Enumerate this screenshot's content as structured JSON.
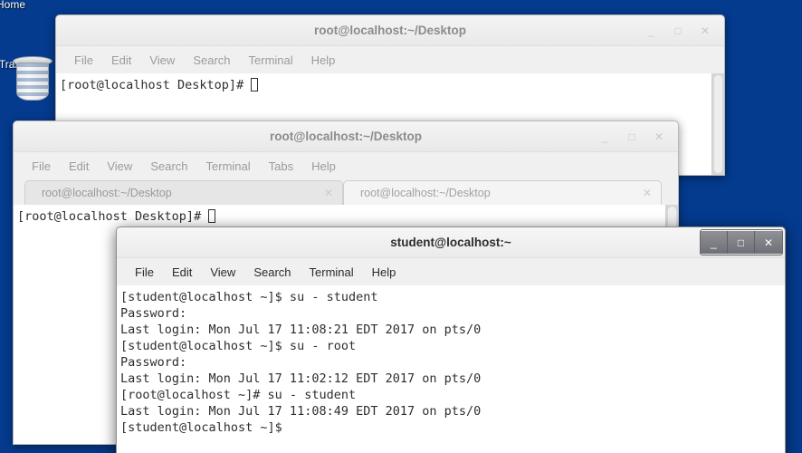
{
  "desktop": {
    "background_color": "#043b8f",
    "icons": [
      {
        "name": "home-folder",
        "label": "Home",
        "icon": "folder-icon"
      },
      {
        "name": "trash",
        "label": "Trash",
        "icon": "trash-icon"
      }
    ]
  },
  "windows": {
    "terminal1": {
      "title": "root@localhost:~/Desktop",
      "active": false,
      "menu": [
        "File",
        "Edit",
        "View",
        "Search",
        "Terminal",
        "Help"
      ],
      "controls": {
        "minimize": "_",
        "maximize": "□",
        "close": "✕"
      },
      "terminal_lines": [
        "[root@localhost Desktop]# "
      ]
    },
    "terminal2": {
      "title": "root@localhost:~/Desktop",
      "active": false,
      "menu": [
        "File",
        "Edit",
        "View",
        "Search",
        "Terminal",
        "Tabs",
        "Help"
      ],
      "controls": {
        "minimize": "_",
        "maximize": "□",
        "close": "✕"
      },
      "tabs": [
        {
          "label": "root@localhost:~/Desktop",
          "selected": false,
          "close": "✕"
        },
        {
          "label": "root@localhost:~/Desktop",
          "selected": true,
          "close": "✕"
        }
      ],
      "terminal_lines": [
        "[root@localhost Desktop]# "
      ]
    },
    "terminal3": {
      "title": "student@localhost:~",
      "active": true,
      "menu": [
        "File",
        "Edit",
        "View",
        "Search",
        "Terminal",
        "Help"
      ],
      "controls": {
        "minimize": "_",
        "maximize": "□",
        "close": "✕"
      },
      "terminal_lines": [
        "[student@localhost ~]$ su - student",
        "Password:",
        "Last login: Mon Jul 17 11:08:21 EDT 2017 on pts/0",
        "[student@localhost ~]$ su - root",
        "Password:",
        "Last login: Mon Jul 17 11:02:12 EDT 2017 on pts/0",
        "[root@localhost ~]# su - student",
        "Last login: Mon Jul 17 11:08:49 EDT 2017 on pts/0",
        "[student@localhost ~]$ "
      ]
    }
  }
}
